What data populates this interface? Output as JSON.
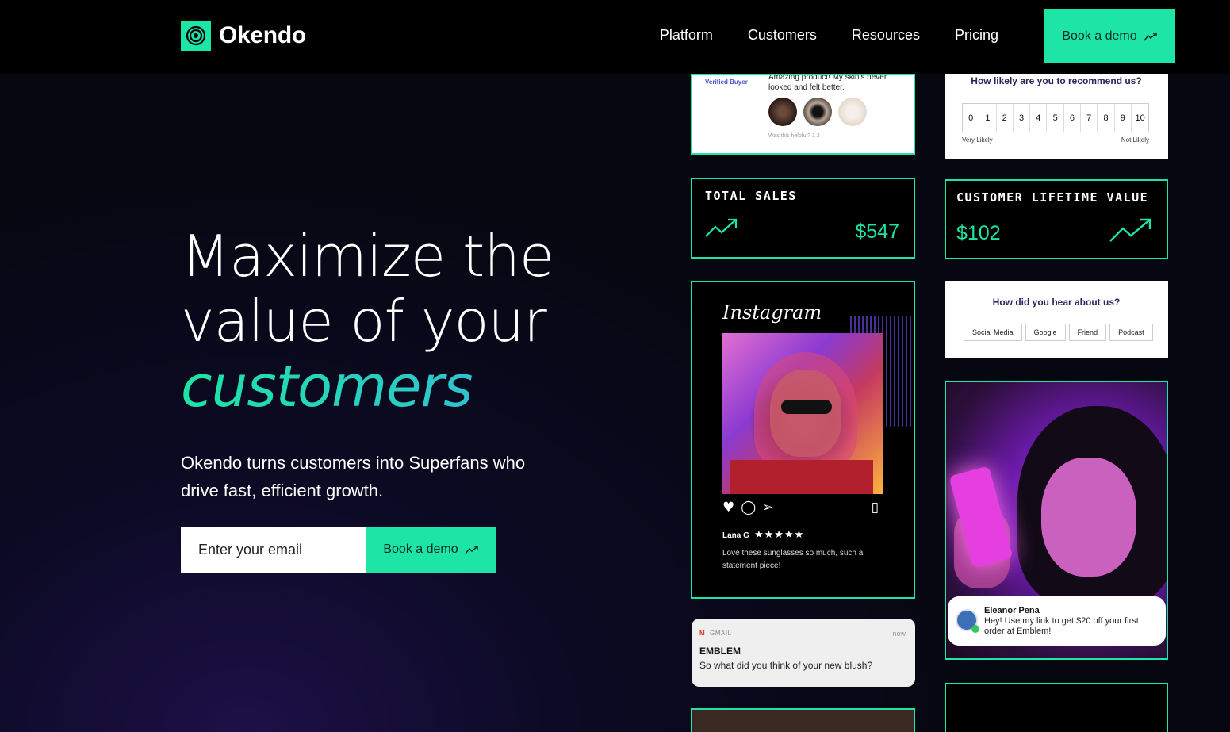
{
  "brand": {
    "name": "Okendo",
    "accent": "#1de5a5"
  },
  "nav": {
    "links": [
      "Platform",
      "Customers",
      "Resources",
      "Pricing"
    ],
    "cta": "Book a demo"
  },
  "hero": {
    "title_line1": "Maximize the",
    "title_line2": "value of your",
    "title_accent": "customers",
    "subtitle": "Okendo turns customers into Superfans who drive fast, efficient growth.",
    "email_placeholder": "Enter your email",
    "cta": "Book a demo"
  },
  "cards": {
    "review": {
      "badge": "Verified Buyer",
      "text": "Amazing product! My skin's never looked and felt better.",
      "helpful": "Was this helpful?  1   2"
    },
    "nps": {
      "question": "How likely are you to recommend us?",
      "scale": [
        "0",
        "1",
        "2",
        "3",
        "4",
        "5",
        "6",
        "7",
        "8",
        "9",
        "10"
      ],
      "low_label": "Very Likely",
      "high_label": "Not Likely"
    },
    "total_sales": {
      "label": "TOTAL SALES",
      "value": "$547"
    },
    "clv": {
      "label": "CUSTOMER LIFETIME VALUE",
      "value": "$102"
    },
    "instagram": {
      "logo": "Instagram",
      "user": "Lana G",
      "stars": "★★★★★",
      "comment": "Love these sunglasses so much, such a statement piece!"
    },
    "survey": {
      "question": "How did you hear about us?",
      "options": [
        "Social Media",
        "Google",
        "Friend",
        "Podcast"
      ]
    },
    "message": {
      "name": "Eleanor Pena",
      "text": "Hey! Use my link to get $20 off your first order at Emblem!"
    },
    "gmail": {
      "source": "GMAIL",
      "time": "now",
      "title": "EMBLEM",
      "body": "So what did you think of your new blush?"
    }
  }
}
